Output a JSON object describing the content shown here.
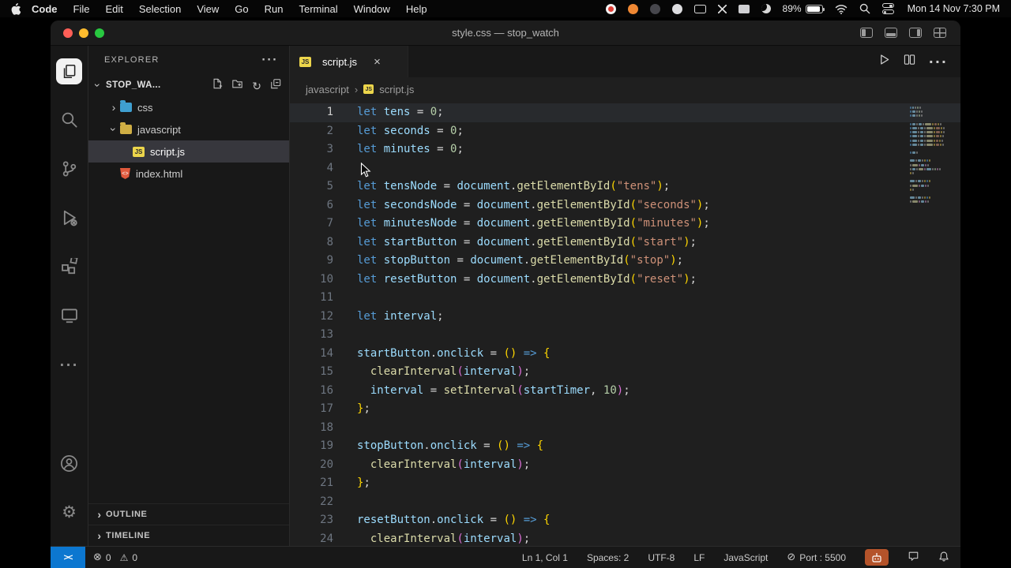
{
  "menubar": {
    "apple_icon": "apple-logo-icon",
    "items": [
      "Code",
      "File",
      "Edit",
      "Selection",
      "View",
      "Go",
      "Run",
      "Terminal",
      "Window",
      "Help"
    ],
    "status_icons": [
      "record-icon",
      "browser-icon",
      "app-icon",
      "chat-icon",
      "display-icon",
      "screen-share-icon",
      "card-icon",
      "moon-icon",
      "wifi-icon",
      "spotlight-icon",
      "control-center-icon"
    ],
    "battery_label": "89%",
    "clock": "Mon 14 Nov 7:30 PM"
  },
  "window": {
    "title": "style.css — stop_watch"
  },
  "activity_bar": {
    "icons": [
      "explorer-icon",
      "search-icon",
      "source-control-icon",
      "run-debug-icon",
      "extensions-icon",
      "live-preview-icon",
      "more-icon"
    ],
    "bottom_icons": [
      "account-icon",
      "settings-gear-icon"
    ]
  },
  "explorer": {
    "header": "EXPLORER",
    "project_name": "STOP_WA...",
    "toolbar_icons": [
      "new-file-icon",
      "new-folder-icon",
      "refresh-icon",
      "collapse-all-icon"
    ],
    "tree": [
      {
        "label": "css",
        "kind": "folder",
        "expanded": false,
        "indent": 0,
        "icon": "folder-css"
      },
      {
        "label": "javascript",
        "kind": "folder",
        "expanded": true,
        "indent": 0,
        "icon": "folder-js"
      },
      {
        "label": "script.js",
        "kind": "file",
        "indent": 1,
        "icon": "js-badge",
        "selected": true
      },
      {
        "label": "index.html",
        "kind": "file",
        "indent": 0,
        "icon": "html-badge"
      }
    ],
    "sections": [
      "OUTLINE",
      "TIMELINE"
    ]
  },
  "editor": {
    "tab": {
      "icon": "js-badge",
      "label": "script.js",
      "close_icon": "close-icon"
    },
    "breadcrumb": {
      "path": [
        "javascript",
        "script.js"
      ],
      "file_icon": "js-badge"
    },
    "actions": [
      "run-icon",
      "split-editor-icon",
      "more-icon"
    ],
    "code": [
      {
        "active": true,
        "tokens": [
          [
            "k",
            "let "
          ],
          [
            "v",
            "tens"
          ],
          [
            "o",
            " = "
          ],
          [
            "num",
            "0"
          ],
          [
            "p",
            ";"
          ]
        ]
      },
      {
        "tokens": [
          [
            "k",
            "let "
          ],
          [
            "v",
            "seconds"
          ],
          [
            "o",
            " = "
          ],
          [
            "num",
            "0"
          ],
          [
            "p",
            ";"
          ]
        ]
      },
      {
        "tokens": [
          [
            "k",
            "let "
          ],
          [
            "v",
            "minutes"
          ],
          [
            "o",
            " = "
          ],
          [
            "num",
            "0"
          ],
          [
            "p",
            ";"
          ]
        ]
      },
      {
        "tokens": []
      },
      {
        "tokens": [
          [
            "k",
            "let "
          ],
          [
            "v",
            "tensNode"
          ],
          [
            "o",
            " = "
          ],
          [
            "v",
            "document"
          ],
          [
            "p",
            "."
          ],
          [
            "f",
            "getElementById"
          ],
          [
            "b",
            "("
          ],
          [
            "s",
            "\"tens\""
          ],
          [
            "b",
            ")"
          ],
          [
            "p",
            ";"
          ]
        ]
      },
      {
        "tokens": [
          [
            "k",
            "let "
          ],
          [
            "v",
            "secondsNode"
          ],
          [
            "o",
            " = "
          ],
          [
            "v",
            "document"
          ],
          [
            "p",
            "."
          ],
          [
            "f",
            "getElementById"
          ],
          [
            "b",
            "("
          ],
          [
            "s",
            "\"seconds\""
          ],
          [
            "b",
            ")"
          ],
          [
            "p",
            ";"
          ]
        ]
      },
      {
        "tokens": [
          [
            "k",
            "let "
          ],
          [
            "v",
            "minutesNode"
          ],
          [
            "o",
            " = "
          ],
          [
            "v",
            "document"
          ],
          [
            "p",
            "."
          ],
          [
            "f",
            "getElementById"
          ],
          [
            "b",
            "("
          ],
          [
            "s",
            "\"minutes\""
          ],
          [
            "b",
            ")"
          ],
          [
            "p",
            ";"
          ]
        ]
      },
      {
        "tokens": [
          [
            "k",
            "let "
          ],
          [
            "v",
            "startButton"
          ],
          [
            "o",
            " = "
          ],
          [
            "v",
            "document"
          ],
          [
            "p",
            "."
          ],
          [
            "f",
            "getElementById"
          ],
          [
            "b",
            "("
          ],
          [
            "s",
            "\"start\""
          ],
          [
            "b",
            ")"
          ],
          [
            "p",
            ";"
          ]
        ]
      },
      {
        "tokens": [
          [
            "k",
            "let "
          ],
          [
            "v",
            "stopButton"
          ],
          [
            "o",
            " = "
          ],
          [
            "v",
            "document"
          ],
          [
            "p",
            "."
          ],
          [
            "f",
            "getElementById"
          ],
          [
            "b",
            "("
          ],
          [
            "s",
            "\"stop\""
          ],
          [
            "b",
            ")"
          ],
          [
            "p",
            ";"
          ]
        ]
      },
      {
        "tokens": [
          [
            "k",
            "let "
          ],
          [
            "v",
            "resetButton"
          ],
          [
            "o",
            " = "
          ],
          [
            "v",
            "document"
          ],
          [
            "p",
            "."
          ],
          [
            "f",
            "getElementById"
          ],
          [
            "b",
            "("
          ],
          [
            "s",
            "\"reset\""
          ],
          [
            "b",
            ")"
          ],
          [
            "p",
            ";"
          ]
        ]
      },
      {
        "tokens": []
      },
      {
        "tokens": [
          [
            "k",
            "let "
          ],
          [
            "v",
            "interval"
          ],
          [
            "p",
            ";"
          ]
        ]
      },
      {
        "tokens": []
      },
      {
        "tokens": [
          [
            "v",
            "startButton"
          ],
          [
            "p",
            "."
          ],
          [
            "v",
            "onclick"
          ],
          [
            "o",
            " = "
          ],
          [
            "b",
            "()"
          ],
          [
            "k",
            " => "
          ],
          [
            "b",
            "{"
          ]
        ]
      },
      {
        "tokens": [
          [
            "p",
            "  "
          ],
          [
            "f",
            "clearInterval"
          ],
          [
            "b2",
            "("
          ],
          [
            "v",
            "interval"
          ],
          [
            "b2",
            ")"
          ],
          [
            "p",
            ";"
          ]
        ]
      },
      {
        "tokens": [
          [
            "p",
            "  "
          ],
          [
            "v",
            "interval"
          ],
          [
            "o",
            " = "
          ],
          [
            "f",
            "setInterval"
          ],
          [
            "b2",
            "("
          ],
          [
            "v",
            "startTimer"
          ],
          [
            "p",
            ", "
          ],
          [
            "num",
            "10"
          ],
          [
            "b2",
            ")"
          ],
          [
            "p",
            ";"
          ]
        ]
      },
      {
        "tokens": [
          [
            "b",
            "}"
          ],
          [
            "p",
            ";"
          ]
        ]
      },
      {
        "tokens": []
      },
      {
        "tokens": [
          [
            "v",
            "stopButton"
          ],
          [
            "p",
            "."
          ],
          [
            "v",
            "onclick"
          ],
          [
            "o",
            " = "
          ],
          [
            "b",
            "()"
          ],
          [
            "k",
            " => "
          ],
          [
            "b",
            "{"
          ]
        ]
      },
      {
        "tokens": [
          [
            "p",
            "  "
          ],
          [
            "f",
            "clearInterval"
          ],
          [
            "b2",
            "("
          ],
          [
            "v",
            "interval"
          ],
          [
            "b2",
            ")"
          ],
          [
            "p",
            ";"
          ]
        ]
      },
      {
        "tokens": [
          [
            "b",
            "}"
          ],
          [
            "p",
            ";"
          ]
        ]
      },
      {
        "tokens": []
      },
      {
        "tokens": [
          [
            "v",
            "resetButton"
          ],
          [
            "p",
            "."
          ],
          [
            "v",
            "onclick"
          ],
          [
            "o",
            " = "
          ],
          [
            "b",
            "()"
          ],
          [
            "k",
            " => "
          ],
          [
            "b",
            "{"
          ]
        ]
      },
      {
        "tokens": [
          [
            "p",
            "  "
          ],
          [
            "f",
            "clearInterval"
          ],
          [
            "b2",
            "("
          ],
          [
            "v",
            "interval"
          ],
          [
            "b2",
            ")"
          ],
          [
            "p",
            ";"
          ]
        ]
      }
    ]
  },
  "status_bar": {
    "remote_icon": "remote-indicator-icon",
    "errors": "0",
    "warnings": "0",
    "cursor": "Ln 1, Col 1",
    "indent": "Spaces: 2",
    "encoding": "UTF-8",
    "eol": "LF",
    "language": "JavaScript",
    "port": "Port : 5500",
    "right_icons": [
      "robot-icon",
      "feedback-icon",
      "bell-icon"
    ]
  },
  "colors": {
    "accent-blue": "#0c77d0",
    "selection-row": "#37373d",
    "js-yellow": "#ecd54b",
    "html-orange": "#e0593c",
    "robot-bg": "#b4532a",
    "traffic-red": "#ff5f57",
    "traffic-yellow": "#febc2e",
    "traffic-green": "#28c840"
  }
}
